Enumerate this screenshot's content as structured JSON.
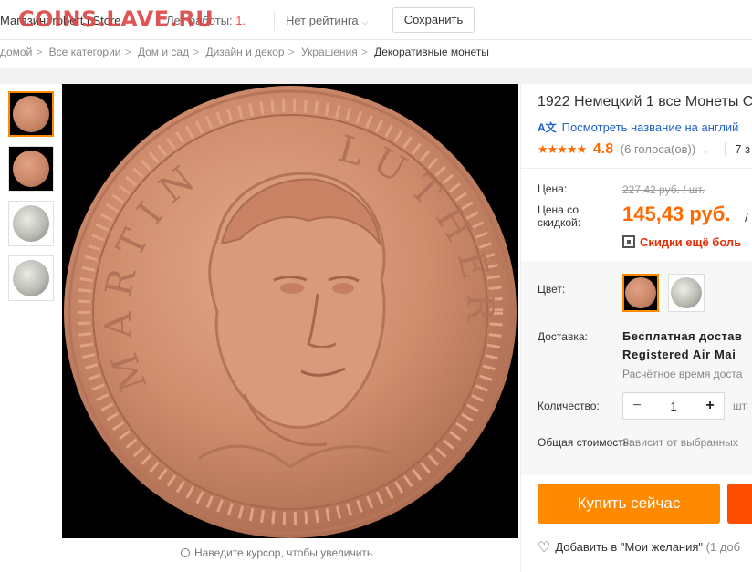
{
  "watermark": "COINS.LAVE.RU",
  "store": {
    "prefix": "Магазин:",
    "name": "robert j Store"
  },
  "store_years": {
    "label": "Лет работы:",
    "value": "1"
  },
  "rating_dropdown": "Нет рейтинга",
  "save_label": "Сохранить",
  "breadcrumb": [
    "домой",
    "Все категории",
    "Дом и сад",
    "Дизайн и декор",
    "Украшения",
    "Декоративные монеты"
  ],
  "gallery": {
    "thumbnails": [
      {
        "kind": "bronze",
        "active": true
      },
      {
        "kind": "bronze",
        "active": false
      },
      {
        "kind": "silver",
        "active": false
      },
      {
        "kind": "silver",
        "active": false
      }
    ],
    "zoom_hint": "Наведите курсор, чтобы увеличить",
    "coin_inscription": "MARTIN LUTHER"
  },
  "product": {
    "title": "1922 Немецкий 1 все Монеты С",
    "translate_link": "Посмотреть название на англий",
    "stars": "★★★★★",
    "score": "4.8",
    "votes": "(6 голоса(ов))",
    "orders": "7 з"
  },
  "price": {
    "label": "Цена:",
    "old": "227,42 руб. / шт.",
    "discount_label": "Цена со скидкой:",
    "new": "145,43 руб.",
    "slash": "/",
    "discounts_link": "Скидки ещё боль"
  },
  "options": {
    "color_label": "Цвет:",
    "swatches": [
      "bronze",
      "silver"
    ]
  },
  "shipping": {
    "label": "Доставка:",
    "line1": "Бесплатная достав",
    "line2": "Registered Air Mai",
    "line3": "Расчётное время доста"
  },
  "quantity": {
    "label": "Количество:",
    "value": "1",
    "unit": "шт.",
    "minus": "−",
    "plus": "+"
  },
  "total": {
    "label": "Общая стоимость:",
    "value": "Зависит от выбранных"
  },
  "actions": {
    "buy": "Купить сейчас",
    "wishlist": "Добавить в \"Мои желания\"",
    "wishlist_count": "(1 доб"
  },
  "colors": {
    "accent": "#ff6a00",
    "buy": "#ff8a00",
    "link": "#2160c4",
    "red": "#e62e04",
    "coin": "#c98767"
  }
}
